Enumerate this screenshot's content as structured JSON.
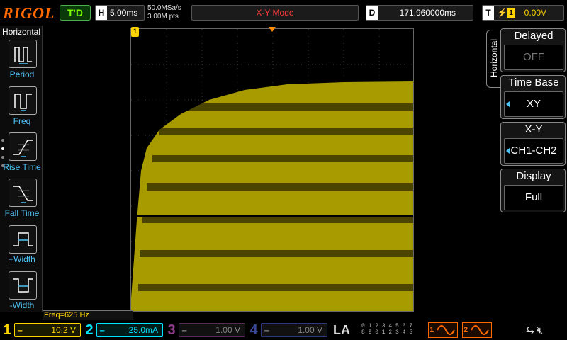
{
  "header": {
    "logo": "RIGOL",
    "run_status": "T'D",
    "timebase_label": "H",
    "timebase_value": "5.00ms",
    "sample_rate": "50.0MSa/s",
    "memory_depth": "3.00M pts",
    "mode_label": "X-Y Mode",
    "delay_label": "D",
    "delay_value": "171.960000ms",
    "trigger_label": "T",
    "trigger_edge_icon": "rising-edge-icon",
    "trigger_source": "1",
    "trigger_level": "0.00V"
  },
  "left_panel": {
    "title": "Horizontal",
    "items": [
      {
        "label": "Period",
        "icon": "period-icon"
      },
      {
        "label": "Freq",
        "icon": "frequency-icon"
      },
      {
        "label": "Rise Time",
        "icon": "rise-time-icon"
      },
      {
        "label": "Fall Time",
        "icon": "fall-time-icon"
      },
      {
        "label": "+Width",
        "icon": "positive-width-icon"
      },
      {
        "label": "-Width",
        "icon": "negative-width-icon"
      }
    ]
  },
  "waveform": {
    "trigger_marker": "1",
    "freq_readout": "Freq=625 Hz",
    "trace_color": "#a89b00"
  },
  "right_panel": {
    "tab_label": "Horizontal",
    "menus": [
      {
        "title": "Delayed",
        "value": "OFF"
      },
      {
        "title": "Time Base",
        "value": "XY"
      },
      {
        "title": "X-Y",
        "value": "CH1-CH2"
      },
      {
        "title": "Display",
        "value": "Full"
      }
    ]
  },
  "channels": [
    {
      "num": "1",
      "coupling": "═",
      "value": "10.2 V",
      "color": "#ffd400"
    },
    {
      "num": "2",
      "coupling": "═",
      "value": "25.0mA",
      "color": "#00e5ff"
    },
    {
      "num": "3",
      "coupling": "═",
      "value": "1.00 V",
      "color": "#c040c0"
    },
    {
      "num": "4",
      "coupling": "═",
      "value": "1.00 V",
      "color": "#4a6aff"
    }
  ],
  "bottom": {
    "la_label": "LA",
    "la_row1": "0 1 2 3   4 5 6 7",
    "la_row2": "8 9 0 1   2 3 4 5",
    "gen1": "1",
    "gen2": "2",
    "usb_icon": "usb-icon",
    "sound_icon": "mute-icon"
  }
}
